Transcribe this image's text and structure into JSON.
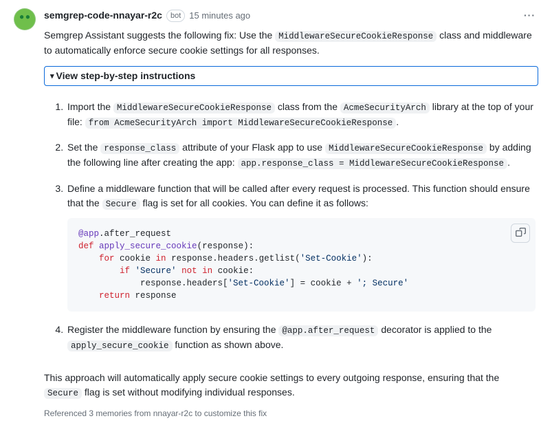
{
  "header": {
    "author": "semgrep-code-nnayar-r2c",
    "bot_badge": "bot",
    "timestamp": "15 minutes ago"
  },
  "intro": {
    "prefix": "Semgrep Assistant suggests the following fix: Use the ",
    "code1": "MiddlewareSecureCookieResponse",
    "suffix1": " class and middleware to automatically enforce secure cookie settings for all responses."
  },
  "details": {
    "summary": "View step-by-step instructions"
  },
  "steps": {
    "s1": {
      "t1": "Import the ",
      "c1": "MiddlewareSecureCookieResponse",
      "t2": " class from the ",
      "c2": "AcmeSecurityArch",
      "t3": " library at the top of your file: ",
      "c3": "from AcmeSecurityArch import MiddlewareSecureCookieResponse",
      "t4": "."
    },
    "s2": {
      "t1": "Set the ",
      "c1": "response_class",
      "t2": " attribute of your Flask app to use ",
      "c2": "MiddlewareSecureCookieResponse",
      "t3": " by adding the following line after creating the app: ",
      "c3": "app.response_class = MiddlewareSecureCookieResponse",
      "t4": "."
    },
    "s3": {
      "t1": "Define a middleware function that will be called after every request is processed. This function should ensure that the ",
      "c1": "Secure",
      "t2": " flag is set for all cookies. You can define it as follows:",
      "code": {
        "l1a": "@app",
        "l1b": ".after_request",
        "l2a": "def",
        "l2b": " ",
        "l2c": "apply_secure_cookie",
        "l2d": "(response):",
        "l3a": "    ",
        "l3b": "for",
        "l3c": " cookie ",
        "l3d": "in",
        "l3e": " response.headers.getlist(",
        "l3f": "'Set-Cookie'",
        "l3g": "):",
        "l4a": "        ",
        "l4b": "if",
        "l4c": " ",
        "l4d": "'Secure'",
        "l4e": " ",
        "l4f": "not in",
        "l4g": " cookie:",
        "l5a": "            response.headers[",
        "l5b": "'Set-Cookie'",
        "l5c": "] = cookie + ",
        "l5d": "'; Secure'",
        "l6a": "    ",
        "l6b": "return",
        "l6c": " response"
      }
    },
    "s4": {
      "t1": "Register the middleware function by ensuring the ",
      "c1": "@app.after_request",
      "t2": " decorator is applied to the ",
      "c2": "apply_secure_cookie",
      "t3": " function as shown above."
    }
  },
  "outro": {
    "t1": "This approach will automatically apply secure cookie settings to every outgoing response, ensuring that the ",
    "c1": "Secure",
    "t2": " flag is set without modifying individual responses."
  },
  "memories": "Referenced 3 memories from nnayar-r2c to customize this fix"
}
